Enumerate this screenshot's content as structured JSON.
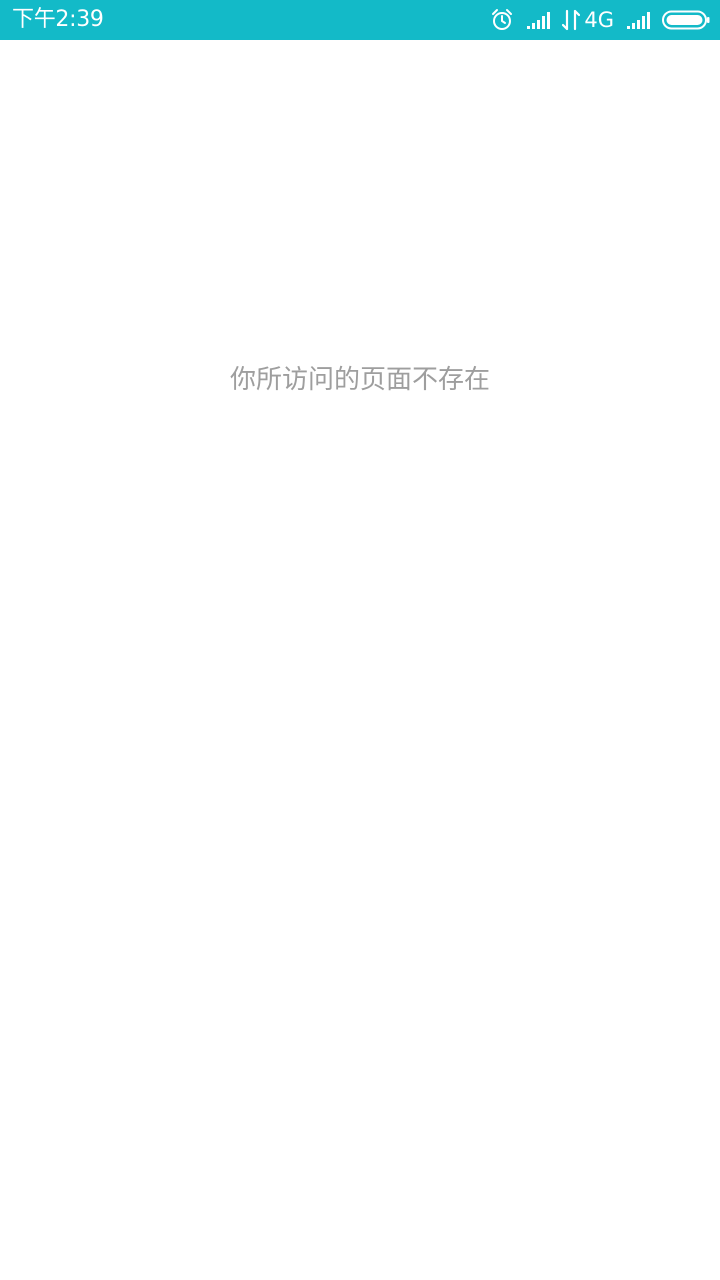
{
  "status_bar": {
    "time": "下午2:39",
    "network_type": "4G",
    "background_color": "#13bac8",
    "icons": [
      "alarm-icon",
      "signal-strength-icon",
      "data-transfer-icon",
      "signal-strength-icon",
      "battery-icon"
    ],
    "battery_level": 1.0
  },
  "main": {
    "message": "你所访问的页面不存在",
    "message_color": "#9e9e9e"
  }
}
